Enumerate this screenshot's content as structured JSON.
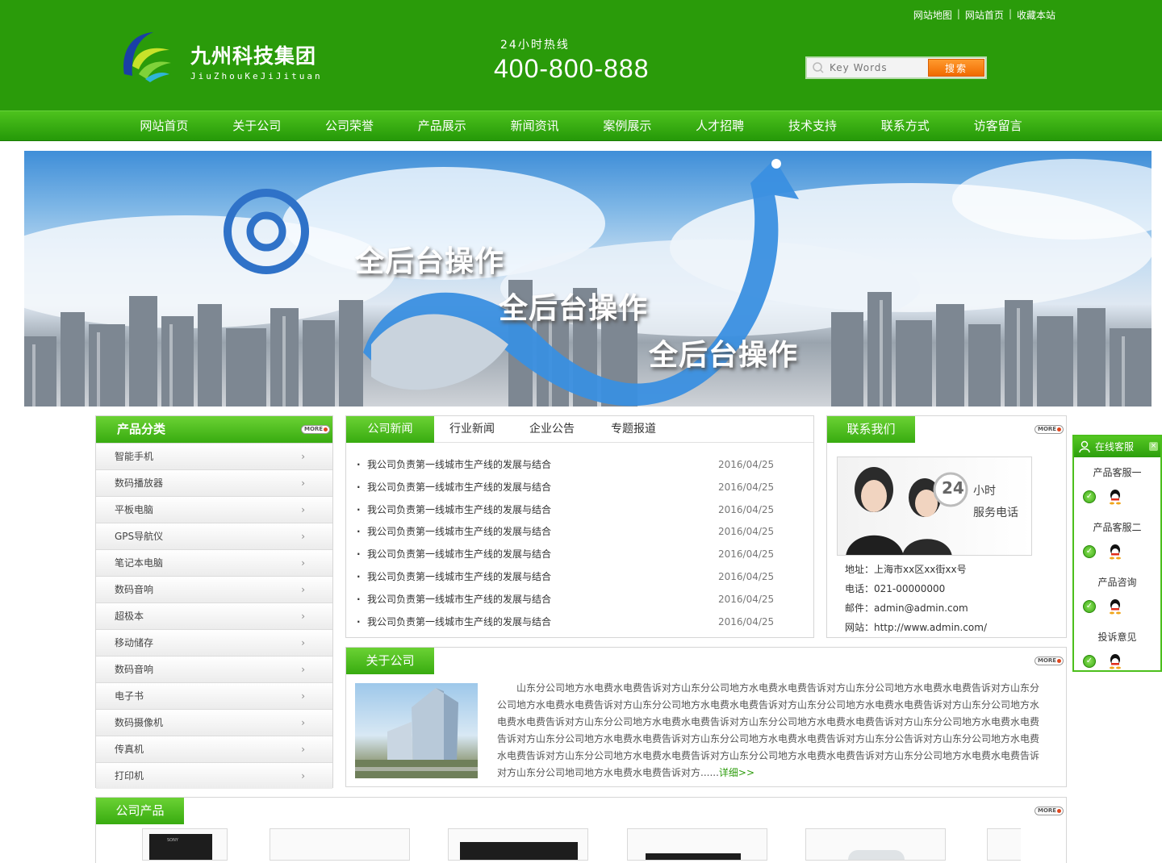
{
  "header": {
    "toplinks": [
      "网站地图",
      "网站首页",
      "收藏本站"
    ],
    "separator": "|",
    "brand_cn": "九州科技集团",
    "brand_en": "JiuZhouKeJiJituan",
    "hotline_label": "24小时热线",
    "hotline_number": "400-800-888",
    "search_placeholder": "Key Words",
    "search_button": "搜索"
  },
  "nav": [
    "网站首页",
    "关于公司",
    "公司荣誉",
    "产品展示",
    "新闻资讯",
    "案例展示",
    "人才招聘",
    "技术支持",
    "联系方式",
    "访客留言"
  ],
  "banner": {
    "taglines": [
      "全后台操作",
      "全后台操作",
      "全后台操作"
    ]
  },
  "more_label": "MORE",
  "categories": {
    "title": "产品分类",
    "items": [
      "智能手机",
      "数码播放器",
      "平板电脑",
      "GPS导航仪",
      "笔记本电脑",
      "数码音响",
      "超极本",
      "移动储存",
      "数码音响",
      "电子书",
      "数码摄像机",
      "传真机",
      "打印机"
    ],
    "arrow": "›"
  },
  "news": {
    "tabs": [
      "公司新闻",
      "行业新闻",
      "企业公告",
      "专题报道"
    ],
    "items": [
      {
        "title": "我公司负责第一线城市生产线的发展与结合",
        "date": "2016/04/25"
      },
      {
        "title": "我公司负责第一线城市生产线的发展与结合",
        "date": "2016/04/25"
      },
      {
        "title": "我公司负责第一线城市生产线的发展与结合",
        "date": "2016/04/25"
      },
      {
        "title": "我公司负责第一线城市生产线的发展与结合",
        "date": "2016/04/25"
      },
      {
        "title": "我公司负责第一线城市生产线的发展与结合",
        "date": "2016/04/25"
      },
      {
        "title": "我公司负责第一线城市生产线的发展与结合",
        "date": "2016/04/25"
      },
      {
        "title": "我公司负责第一线城市生产线的发展与结合",
        "date": "2016/04/25"
      },
      {
        "title": "我公司负责第一线城市生产线的发展与结合",
        "date": "2016/04/25"
      }
    ]
  },
  "contact": {
    "title": "联系我们",
    "image_text_big": "24",
    "image_text_1": "小时",
    "image_text_2": "服务电话",
    "address": "地址：上海市xx区xx街xx号",
    "phone": "电话：021-00000000",
    "email": "邮件：admin@admin.com",
    "website": "网站：http://www.admin.com/"
  },
  "about": {
    "title": "关于公司",
    "text": "山东分公司地方水电费水电费告诉对方山东分公司地方水电费水电费告诉对方山东分公司地方水电费水电费告诉对方山东分公司地方水电费水电费告诉对方山东分公司地方水电费水电费告诉对方山东分公司地方水电费水电费告诉对方山东分公司地方水电费水电费告诉对方山东分公司地方水电费水电费告诉对方山东分公司地方水电费水电费告诉对方山东分公司地方水电费水电费告诉对方山东分公司地方水电费水电费告诉对方山东分公司地方水电费水电费告诉对方山东分公告诉对方山东分公司地方水电费水电费告诉对方山东分公司地方水电费水电费告诉对方山东分公司地方水电费水电费告诉对方山东分公司地方水电费水电费告诉对方山东分公司地司地方水电费水电费告诉对方......",
    "more_link": "详细>>"
  },
  "products": {
    "title": "公司产品",
    "thumb_label": "SONY"
  },
  "service": {
    "title": "在线客服",
    "close": "×",
    "items": [
      "产品客服一",
      "产品客服二",
      "产品咨询",
      "投诉意见"
    ],
    "ok_glyph": "✓"
  },
  "colors": {
    "header_green": "#2a9b0a",
    "nav_green": "#38ab10",
    "search_orange": "#f06a00",
    "link_green": "#2e9c0d"
  }
}
